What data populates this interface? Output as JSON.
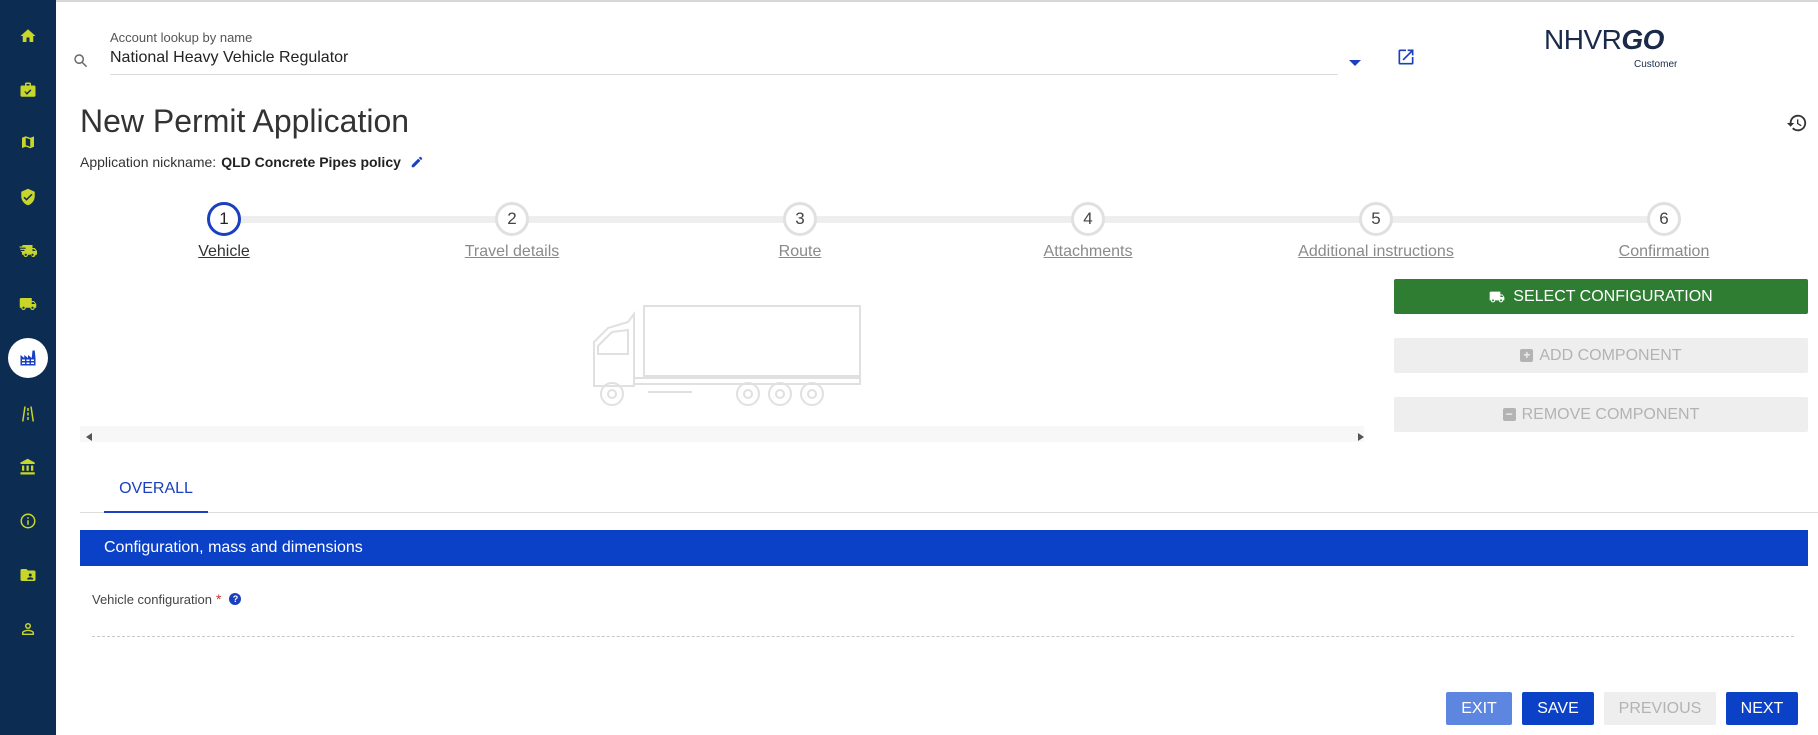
{
  "sidebar": {
    "items": [
      {
        "name": "home-icon",
        "active": false
      },
      {
        "name": "briefcase-check-icon",
        "active": false
      },
      {
        "name": "map-icon",
        "active": false
      },
      {
        "name": "shield-check-icon",
        "active": false
      },
      {
        "name": "truck-fast-icon",
        "active": false
      },
      {
        "name": "truck-icon",
        "active": false
      },
      {
        "name": "factory-icon",
        "active": true
      },
      {
        "name": "road-icon",
        "active": false
      },
      {
        "name": "bank-icon",
        "active": false
      },
      {
        "name": "info-icon",
        "active": false
      },
      {
        "name": "folder-account-icon",
        "active": false
      },
      {
        "name": "account-icon",
        "active": false
      }
    ],
    "accent_color": "#c7d629",
    "background_color": "#0d2c52"
  },
  "lookup": {
    "label": "Account lookup by name",
    "value": "National Heavy Vehicle Regulator"
  },
  "logo": {
    "main": "NHVR",
    "go": "GO",
    "sub": "Customer"
  },
  "page": {
    "title": "New Permit Application",
    "nickname_label": "Application nickname:",
    "nickname_value": "QLD Concrete Pipes policy"
  },
  "stepper": {
    "steps": [
      {
        "number": "1",
        "label": "Vehicle",
        "active": true
      },
      {
        "number": "2",
        "label": "Travel details",
        "active": false
      },
      {
        "number": "3",
        "label": "Route",
        "active": false
      },
      {
        "number": "4",
        "label": "Attachments",
        "active": false
      },
      {
        "number": "5",
        "label": "Additional instructions",
        "active": false
      },
      {
        "number": "6",
        "label": "Confirmation",
        "active": false
      }
    ]
  },
  "actions": {
    "select_configuration": "SELECT CONFIGURATION",
    "add_component": "ADD COMPONENT",
    "remove_component": "REMOVE COMPONENT"
  },
  "tabs": {
    "overall": "OVERALL"
  },
  "section": {
    "title": "Configuration, mass and dimensions",
    "field_label": "Vehicle configuration",
    "required_mark": "*",
    "help_glyph": "?"
  },
  "footer": {
    "exit": "EXIT",
    "save": "SAVE",
    "previous": "PREVIOUS",
    "next": "NEXT"
  },
  "colors": {
    "primary": "#0b41c7",
    "success": "#2e7d32",
    "disabled_bg": "#eeeeee",
    "disabled_text": "#b3b3b3"
  }
}
